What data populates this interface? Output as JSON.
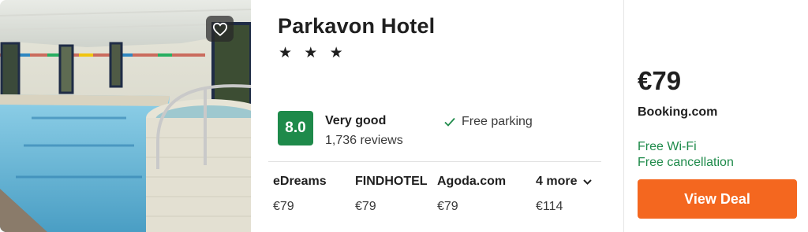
{
  "hotel": {
    "name": "Parkavon Hotel",
    "stars": "★ ★ ★",
    "photo_icon": "hotel-pool-photo",
    "favorite_icon": "heart-outline-icon"
  },
  "rating": {
    "score": "8.0",
    "label": "Very good",
    "reviews": "1,736 reviews",
    "color": "#1e8a4a"
  },
  "amenities": [
    {
      "label": "Free parking",
      "icon": "check-icon"
    }
  ],
  "offers": [
    {
      "provider": "eDreams",
      "price": "€79"
    },
    {
      "provider": "FINDHOTEL",
      "price": "€79"
    },
    {
      "provider": "Agoda.com",
      "price": "€79"
    }
  ],
  "more_offers": {
    "label": "4 more",
    "price": "€114",
    "icon": "chevron-down-icon"
  },
  "deal": {
    "price": "€79",
    "provider": "Booking.com",
    "perks": [
      "Free Wi-Fi",
      "Free cancellation"
    ],
    "button_label": "View Deal",
    "button_color": "#f4671f",
    "perk_color": "#1e8a4a"
  }
}
